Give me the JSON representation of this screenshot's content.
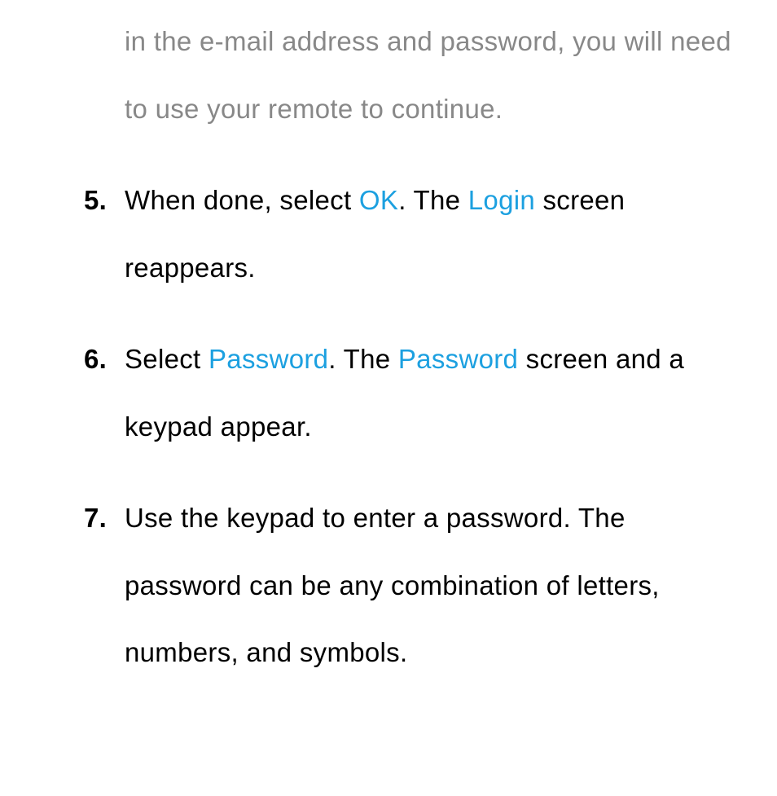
{
  "intro": {
    "text": "in the e-mail address and password, you will need to use your remote to continue."
  },
  "steps": [
    {
      "number": "5.",
      "parts": [
        {
          "text": "When done, select ",
          "highlight": false
        },
        {
          "text": "OK",
          "highlight": true
        },
        {
          "text": ". The ",
          "highlight": false
        },
        {
          "text": "Login",
          "highlight": true
        },
        {
          "text": " screen reappears.",
          "highlight": false
        }
      ]
    },
    {
      "number": "6.",
      "parts": [
        {
          "text": "Select ",
          "highlight": false
        },
        {
          "text": "Password",
          "highlight": true
        },
        {
          "text": ". The ",
          "highlight": false
        },
        {
          "text": "Password",
          "highlight": true
        },
        {
          "text": " screen and a keypad appear.",
          "highlight": false
        }
      ]
    },
    {
      "number": "7.",
      "parts": [
        {
          "text": "Use the keypad to enter a password. The password can be any combination of letters, numbers, and symbols.",
          "highlight": false
        }
      ]
    }
  ]
}
